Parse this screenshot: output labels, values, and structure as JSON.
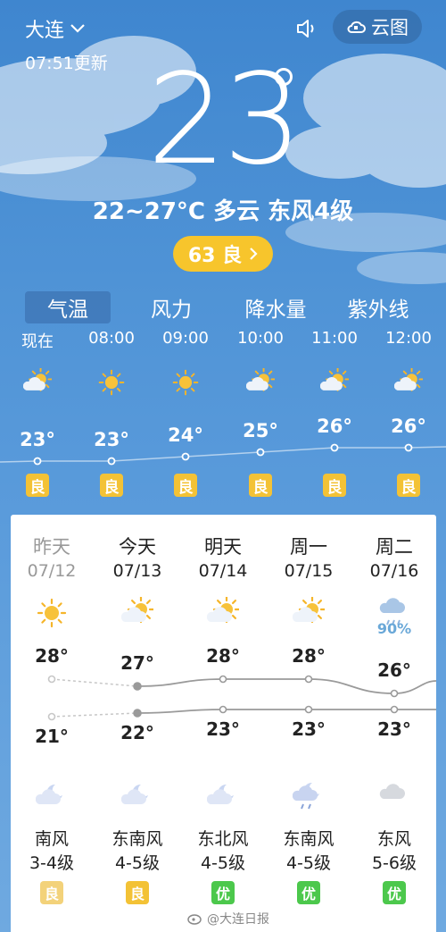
{
  "header": {
    "city": "大连",
    "updated": "07:51更新",
    "cloudmap_label": "云图"
  },
  "current": {
    "temperature": "23",
    "summary": "22~27°C 多云 东风4级",
    "aqi_label": "63 良"
  },
  "tabs": [
    "气温",
    "风力",
    "降水量",
    "紫外线"
  ],
  "hourly": [
    {
      "time": "现在",
      "icon": "partly-cloudy-icon",
      "temp": "23°",
      "temp_value": 23,
      "aqi": "良"
    },
    {
      "time": "08:00",
      "icon": "sun-icon",
      "temp": "23°",
      "temp_value": 23,
      "aqi": "良"
    },
    {
      "time": "09:00",
      "icon": "sun-icon",
      "temp": "24°",
      "temp_value": 24,
      "aqi": "良"
    },
    {
      "time": "10:00",
      "icon": "partly-cloudy-icon",
      "temp": "25°",
      "temp_value": 25,
      "aqi": "良"
    },
    {
      "time": "11:00",
      "icon": "partly-cloudy-icon",
      "temp": "26°",
      "temp_value": 26,
      "aqi": "良"
    },
    {
      "time": "12:00",
      "icon": "partly-cloudy-icon",
      "temp": "26°",
      "temp_value": 26,
      "aqi": "良"
    }
  ],
  "daily": [
    {
      "name": "昨天",
      "date": "07/12",
      "day_icon": "sun-icon",
      "precip": "",
      "high": "28°",
      "high_value": 28,
      "low": "21°",
      "low_value": 21,
      "night_icon": "moon-cloud-icon",
      "wind_dir": "南风",
      "wind_level": "3-4级",
      "aqi": "良",
      "aqi_color": "#f3d27a",
      "past": true
    },
    {
      "name": "今天",
      "date": "07/13",
      "day_icon": "partly-cloudy-icon",
      "precip": "",
      "high": "27°",
      "high_value": 27,
      "low": "22°",
      "low_value": 22,
      "night_icon": "moon-cloud-icon",
      "wind_dir": "东南风",
      "wind_level": "4-5级",
      "aqi": "良",
      "aqi_color": "#f3c236",
      "past": false
    },
    {
      "name": "明天",
      "date": "07/14",
      "day_icon": "partly-cloudy-icon",
      "precip": "",
      "high": "28°",
      "high_value": 28,
      "low": "23°",
      "low_value": 23,
      "night_icon": "moon-cloud-icon",
      "wind_dir": "东北风",
      "wind_level": "4-5级",
      "aqi": "优",
      "aqi_color": "#4cc84c",
      "past": false
    },
    {
      "name": "周一",
      "date": "07/15",
      "day_icon": "partly-cloudy-icon",
      "precip": "",
      "high": "28°",
      "high_value": 28,
      "low": "23°",
      "low_value": 23,
      "night_icon": "moon-rain-icon",
      "wind_dir": "东南风",
      "wind_level": "4-5级",
      "aqi": "优",
      "aqi_color": "#4cc84c",
      "past": false
    },
    {
      "name": "周二",
      "date": "07/16",
      "day_icon": "rain-cloud-icon",
      "precip": "90%",
      "high": "26°",
      "high_value": 26,
      "low": "23°",
      "low_value": 23,
      "night_icon": "cloud-icon",
      "wind_dir": "东风",
      "wind_level": "5-6级",
      "aqi": "优",
      "aqi_color": "#4cc84c",
      "past": false
    }
  ],
  "watermark": "@大连日报",
  "colors": {
    "aqi_good": "#f3c236",
    "aqi_excellent": "#4cc84c",
    "aqi_pill": "#f7c52c"
  }
}
